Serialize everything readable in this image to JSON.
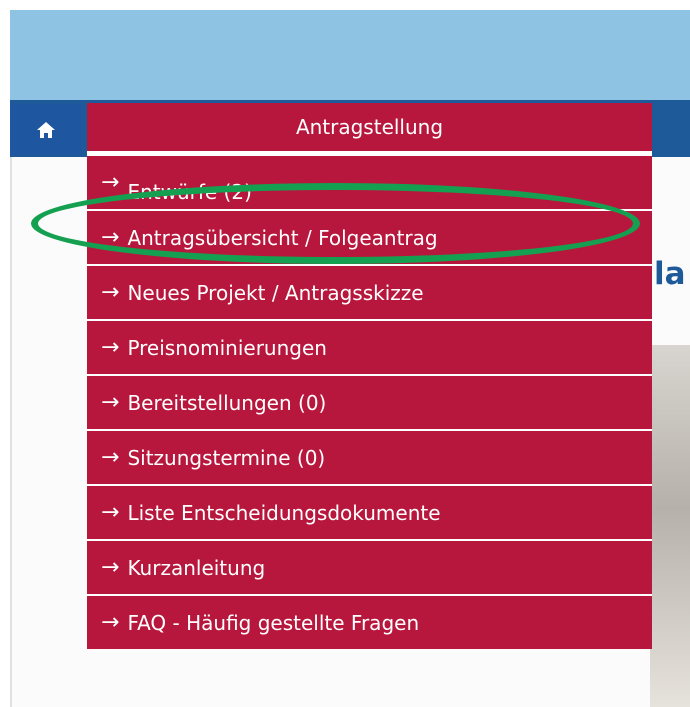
{
  "nav": {
    "home_icon": "home-icon",
    "menu_title": "Antragstellung"
  },
  "menu": {
    "items": [
      {
        "label": "Entwürfe (2)"
      },
      {
        "label": "Antragsübersicht / Folgeantrag"
      },
      {
        "label": "Neues Projekt / Antragsskizze"
      },
      {
        "label": "Preisnominierungen"
      },
      {
        "label": "Bereitstellungen (0)"
      },
      {
        "label": "Sitzungstermine (0)"
      },
      {
        "label": "Liste Entscheidungsdokumente"
      },
      {
        "label": "Kurzanleitung"
      },
      {
        "label": "FAQ - Häufig gestellte Fragen"
      }
    ],
    "arrow": "→"
  },
  "page": {
    "heading_partial": "la"
  },
  "colors": {
    "menu_bg": "#b8173d",
    "nav_bg": "#1e5a9a",
    "banner_bg": "#8fc3e4",
    "highlight": "#14a050"
  }
}
